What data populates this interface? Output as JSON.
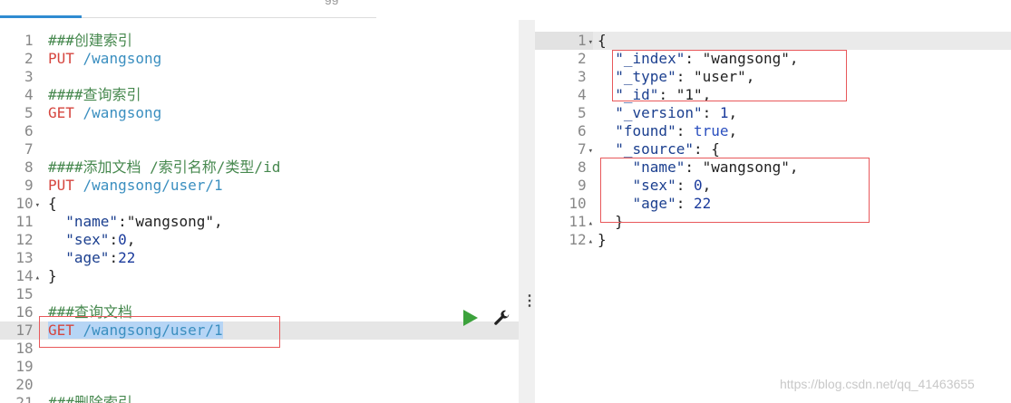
{
  "top_tab_fragment": "gg",
  "request": {
    "lines": [
      {
        "num": "1",
        "parts": [
          {
            "t": "###创建索引",
            "c": "comment"
          }
        ]
      },
      {
        "num": "2",
        "parts": [
          {
            "t": "PUT",
            "c": "method"
          },
          {
            "t": " /wangsong",
            "c": "path"
          }
        ]
      },
      {
        "num": "3",
        "parts": []
      },
      {
        "num": "4",
        "parts": [
          {
            "t": "####查询索引",
            "c": "comment"
          }
        ]
      },
      {
        "num": "5",
        "parts": [
          {
            "t": "GET",
            "c": "method"
          },
          {
            "t": " /wangsong",
            "c": "path"
          }
        ]
      },
      {
        "num": "6",
        "parts": []
      },
      {
        "num": "7",
        "parts": []
      },
      {
        "num": "8",
        "parts": [
          {
            "t": "####添加文档 /索引名称/类型/id",
            "c": "comment"
          }
        ]
      },
      {
        "num": "9",
        "parts": [
          {
            "t": "PUT",
            "c": "method"
          },
          {
            "t": " /wangsong/user/1",
            "c": "path"
          }
        ]
      },
      {
        "num": "10",
        "fold": "down",
        "parts": [
          {
            "t": "{",
            "c": "str"
          }
        ]
      },
      {
        "num": "11",
        "parts": [
          {
            "t": "  \"name\"",
            "c": "key"
          },
          {
            "t": ":\"wangsong\",",
            "c": "str"
          }
        ]
      },
      {
        "num": "12",
        "parts": [
          {
            "t": "  \"sex\"",
            "c": "key"
          },
          {
            "t": ":",
            "c": "str"
          },
          {
            "t": "0",
            "c": "num"
          },
          {
            "t": ",",
            "c": "str"
          }
        ]
      },
      {
        "num": "13",
        "parts": [
          {
            "t": "  \"age\"",
            "c": "key"
          },
          {
            "t": ":",
            "c": "str"
          },
          {
            "t": "22",
            "c": "num"
          }
        ]
      },
      {
        "num": "14",
        "fold": "up",
        "parts": [
          {
            "t": "}",
            "c": "str"
          }
        ]
      },
      {
        "num": "15",
        "parts": []
      },
      {
        "num": "16",
        "parts": [
          {
            "t": "###查询文档",
            "c": "comment"
          }
        ]
      },
      {
        "num": "17",
        "active": true,
        "parts": [
          {
            "t": "GET",
            "c": "method sel"
          },
          {
            "t": " /wangsong/user/1",
            "c": "path sel"
          }
        ]
      },
      {
        "num": "18",
        "parts": []
      },
      {
        "num": "19",
        "parts": []
      },
      {
        "num": "20",
        "parts": []
      },
      {
        "num": "21",
        "parts": [
          {
            "t": "###删除索引",
            "c": "comment"
          }
        ]
      }
    ]
  },
  "response": {
    "lines": [
      {
        "num": "1",
        "fold": "down",
        "active": true,
        "parts": [
          {
            "t": "{",
            "c": "str"
          }
        ]
      },
      {
        "num": "2",
        "parts": [
          {
            "t": "  \"_index\"",
            "c": "key"
          },
          {
            "t": ": \"wangsong\",",
            "c": "str"
          }
        ]
      },
      {
        "num": "3",
        "parts": [
          {
            "t": "  \"_type\"",
            "c": "key"
          },
          {
            "t": ": \"user\",",
            "c": "str"
          }
        ]
      },
      {
        "num": "4",
        "parts": [
          {
            "t": "  \"_id\"",
            "c": "key"
          },
          {
            "t": ": \"1\",",
            "c": "str"
          }
        ]
      },
      {
        "num": "5",
        "parts": [
          {
            "t": "  \"_version\"",
            "c": "key"
          },
          {
            "t": ": ",
            "c": "str"
          },
          {
            "t": "1",
            "c": "num"
          },
          {
            "t": ",",
            "c": "str"
          }
        ]
      },
      {
        "num": "6",
        "parts": [
          {
            "t": "  \"found\"",
            "c": "key"
          },
          {
            "t": ": ",
            "c": "str"
          },
          {
            "t": "true",
            "c": "bool"
          },
          {
            "t": ",",
            "c": "str"
          }
        ]
      },
      {
        "num": "7",
        "fold": "down",
        "parts": [
          {
            "t": "  \"_source\"",
            "c": "key"
          },
          {
            "t": ": {",
            "c": "str"
          }
        ]
      },
      {
        "num": "8",
        "parts": [
          {
            "t": "    \"name\"",
            "c": "key"
          },
          {
            "t": ": \"wangsong\",",
            "c": "str"
          }
        ]
      },
      {
        "num": "9",
        "parts": [
          {
            "t": "    \"sex\"",
            "c": "key"
          },
          {
            "t": ": ",
            "c": "str"
          },
          {
            "t": "0",
            "c": "num"
          },
          {
            "t": ",",
            "c": "str"
          }
        ]
      },
      {
        "num": "10",
        "parts": [
          {
            "t": "    \"age\"",
            "c": "key"
          },
          {
            "t": ": ",
            "c": "str"
          },
          {
            "t": "22",
            "c": "num"
          }
        ]
      },
      {
        "num": "11",
        "fold": "up",
        "parts": [
          {
            "t": "  }",
            "c": "str"
          }
        ]
      },
      {
        "num": "12",
        "fold": "up",
        "parts": [
          {
            "t": "}",
            "c": "str"
          }
        ]
      }
    ]
  },
  "toolbar": {
    "run_icon": "play-icon",
    "settings_icon": "wrench-icon"
  },
  "watermark": "https://blog.csdn.net/qq_41463655"
}
